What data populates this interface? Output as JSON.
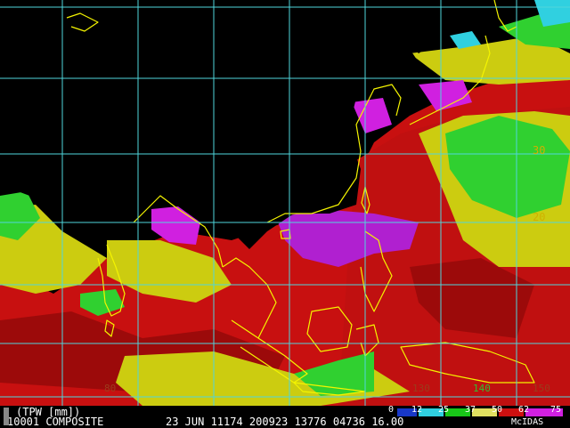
{
  "colors": {
    "background": "#000000",
    "grid": "#4fd6dc",
    "coastline": "#f4f400",
    "red": "#cc1010",
    "darkred": "#9c0a0a",
    "yellow": "#cccc10",
    "lightyellow": "#e0e060",
    "green": "#18c818",
    "lightgreen": "#40e040",
    "magenta": "#d020e0",
    "purple": "#a020c0",
    "cyan": "#30d0e0",
    "blue": "#1838c8"
  },
  "map_labels": {
    "lon_80": "80",
    "lon_130": "130",
    "lon_140": "140",
    "lon_150": "150",
    "lat_30": "30",
    "lat_20": "20"
  },
  "footer": {
    "field_label": "(TPW [mm])",
    "product": "10001 COMPOSITE",
    "timestamp": "23 JUN 11174 200923 13776 04736 16.00",
    "brand": "McIDAS"
  },
  "legend": {
    "ticks": [
      "0",
      "12",
      "25",
      "37",
      "50",
      "62",
      "75"
    ],
    "colors": [
      "#1838c8",
      "#30d0e0",
      "#18c818",
      "#e0e060",
      "#cc1010",
      "#d020e0"
    ]
  }
}
